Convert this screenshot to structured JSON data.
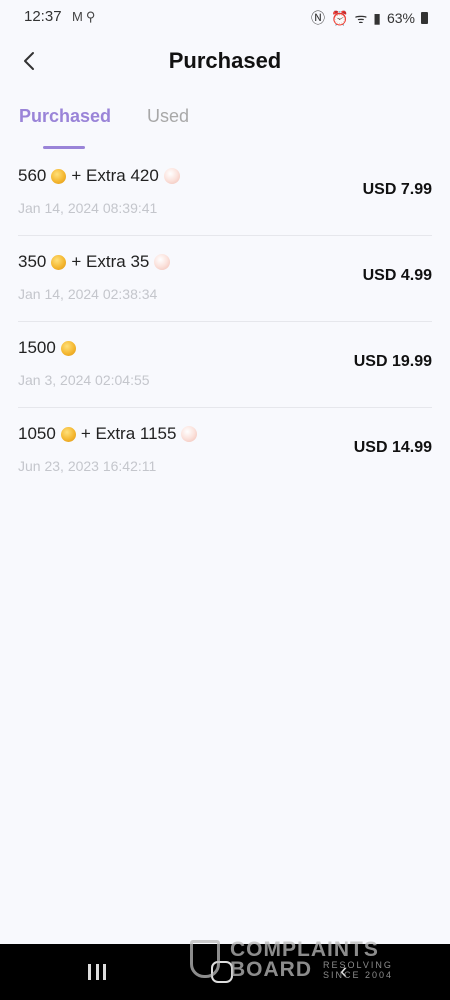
{
  "status_bar": {
    "time": "12:37",
    "left_icons": [
      "mail-icon",
      "flashlight-icon"
    ],
    "battery": "63%"
  },
  "header": {
    "title": "Purchased"
  },
  "tabs": [
    {
      "label": "Purchased",
      "active": true
    },
    {
      "label": "Used",
      "active": false
    }
  ],
  "items": [
    {
      "amount": "560",
      "plus": "+ Extra",
      "extra": "420",
      "date": "Jan 14, 2024 08:39:41",
      "price": "USD 7.99"
    },
    {
      "amount": "350",
      "plus": "+ Extra",
      "extra": "35",
      "date": "Jan 14, 2024 02:38:34",
      "price": "USD 4.99"
    },
    {
      "amount": "1500",
      "plus": "",
      "extra": "",
      "date": "Jan 3, 2024 02:04:55",
      "price": "USD 19.99"
    },
    {
      "amount": "1050",
      "plus": "+ Extra",
      "extra": "1155",
      "date": "Jun 23, 2023 16:42:11",
      "price": "USD 14.99"
    }
  ],
  "watermark": {
    "line1": "COMPLAINTS",
    "line2": "BOARD",
    "line3": "RESOLVING SINCE 2004"
  },
  "colors": {
    "accent": "#9a84d8",
    "background": "#f8f9fd",
    "coin": "#f4b730",
    "pearl": "#fbe2dc"
  }
}
